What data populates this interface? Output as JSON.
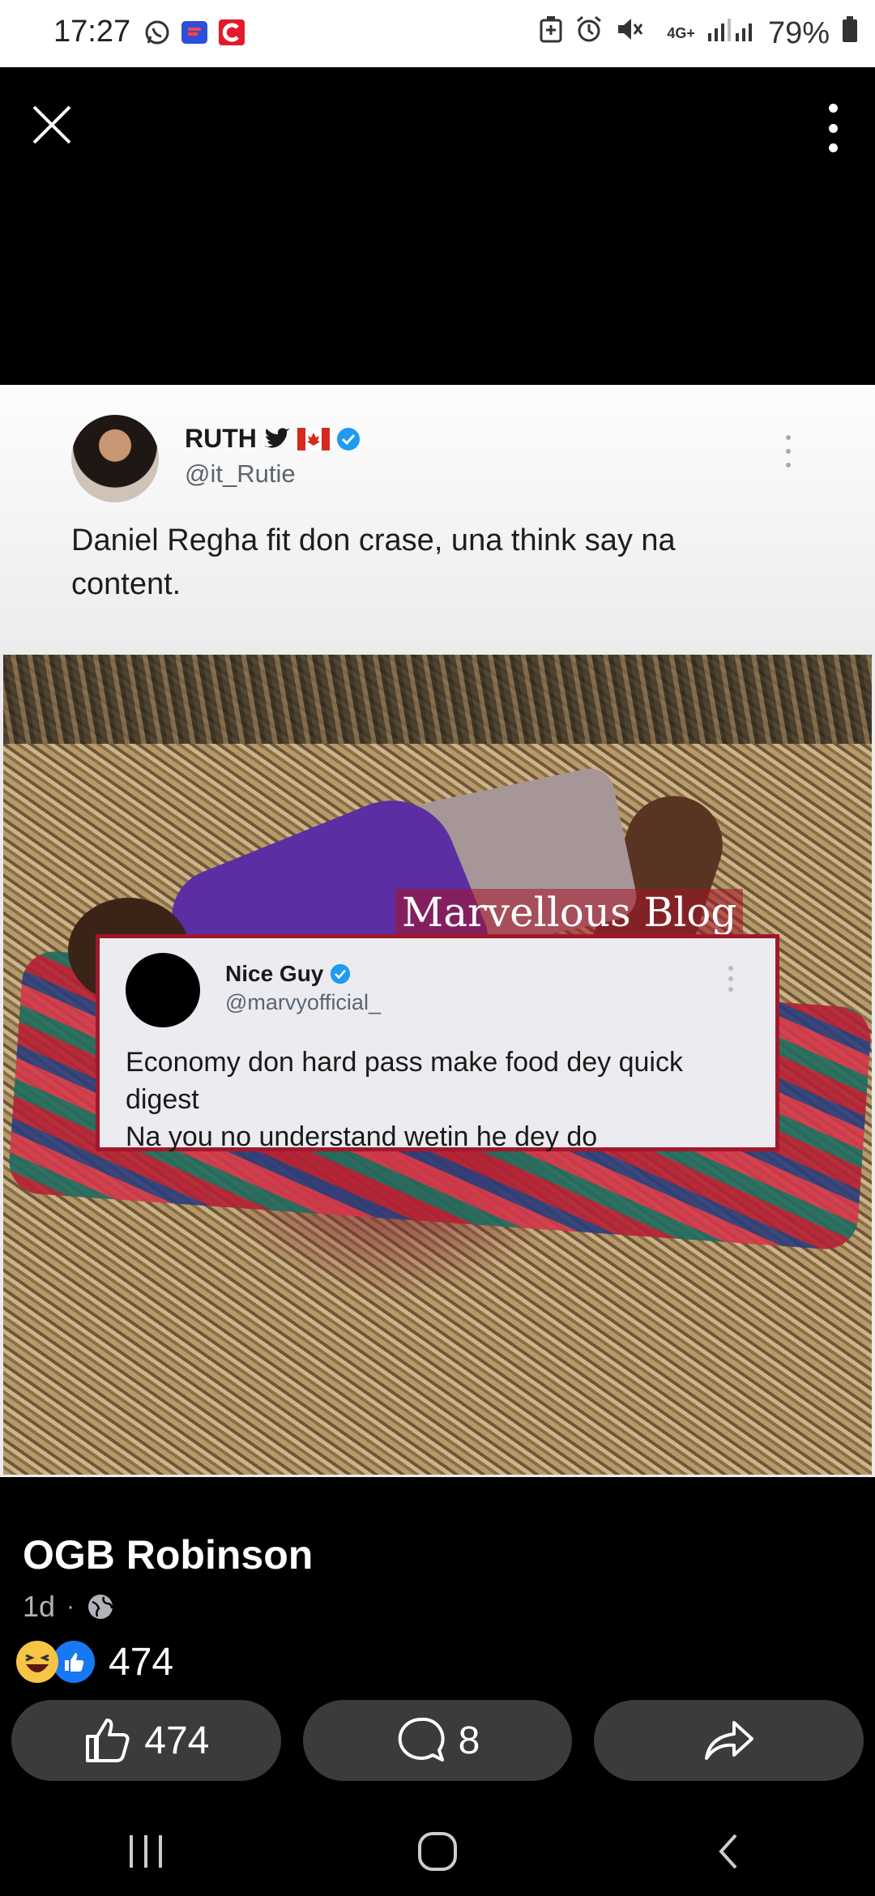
{
  "status_bar": {
    "time": "17:27",
    "network": "4G+",
    "battery_percent": "79%"
  },
  "tweet": {
    "name": "RUTH",
    "handle": "@it_Rutie",
    "text": "Daniel Regha fit don crase, una think say na content."
  },
  "watermark": "Marvellous Blog",
  "quoted_tweet": {
    "name": "Nice Guy",
    "handle": "@marvyofficial_",
    "text_line1": "Economy don hard pass make food dey quick digest",
    "text_line2": "Na you no understand wetin he dey do"
  },
  "post": {
    "author": "OGB Robinson",
    "time_ago": "1d",
    "reaction_count": "474"
  },
  "actions": {
    "like_count": "474",
    "comment_count": "8"
  },
  "colors": {
    "verified_blue": "#1d9bf0",
    "like_blue": "#1877f2",
    "quote_border": "#a3172b",
    "button_bg": "#3a3b3c"
  },
  "icons": [
    "whatsapp-icon",
    "messenger-icon",
    "c-app-icon",
    "battery-saver-icon",
    "alarm-icon",
    "mute-icon",
    "signal-icon",
    "battery-icon",
    "close-icon",
    "more-icon",
    "twitter-icon",
    "canada-flag-icon",
    "verified-icon",
    "globe-icon",
    "haha-icon",
    "like-icon",
    "comment-icon",
    "share-icon",
    "recents-icon",
    "home-icon",
    "back-icon"
  ]
}
